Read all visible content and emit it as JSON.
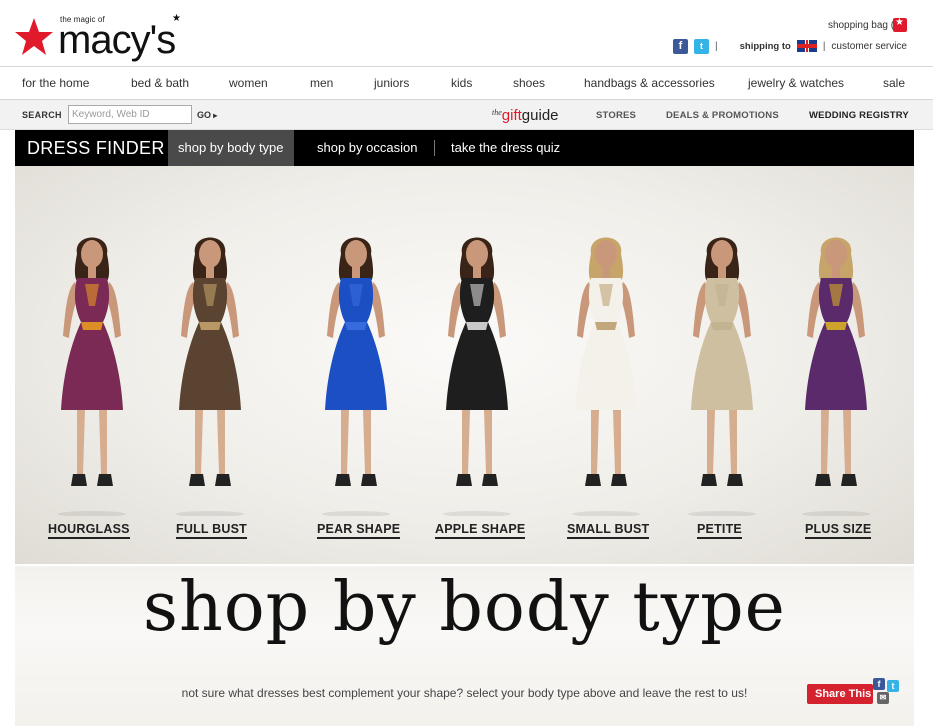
{
  "header": {
    "logo_tagline": "the magic of",
    "logo_word": "macy's",
    "shopping_bag": "shopping bag (0)",
    "shipping_label": "shipping to",
    "customer_service": "customer service",
    "separator": "|"
  },
  "main_nav": [
    "for the home",
    "bed & bath",
    "women",
    "men",
    "juniors",
    "kids",
    "shoes",
    "handbags & accessories",
    "jewelry & watches",
    "sale"
  ],
  "search": {
    "label": "SEARCH",
    "placeholder": "Keyword, Web ID",
    "go": "GO"
  },
  "gift_guide": {
    "the": "the",
    "gift": "gift",
    "guide": "guide"
  },
  "sub_links": {
    "stores": "STORES",
    "deals": "DEALS & PROMOTIONS",
    "registry": "WEDDING REGISTRY"
  },
  "dress_finder": {
    "title": "DRESS FINDER",
    "tabs": [
      "shop by body type",
      "shop by occasion",
      "take the dress quiz"
    ]
  },
  "body_types": [
    {
      "label": "HOURGLASS",
      "dress_color": "#7a2a55",
      "accent": "#f0a020"
    },
    {
      "label": "FULL BUST",
      "dress_color": "#5a4330",
      "accent": "#c9a870"
    },
    {
      "label": "PEAR SHAPE",
      "dress_color": "#1c4fc4",
      "accent": "#3a70e0"
    },
    {
      "label": "APPLE SHAPE",
      "dress_color": "#1e1e1e",
      "accent": "#e8e8e8"
    },
    {
      "label": "SMALL BUST",
      "dress_color": "#f4f1ea",
      "accent": "#b89a6a"
    },
    {
      "label": "PETITE",
      "dress_color": "#cdbf9f",
      "accent": "#bfb08e"
    },
    {
      "label": "PLUS SIZE",
      "dress_color": "#5a2a6a",
      "accent": "#e2b820"
    }
  ],
  "promo": {
    "title": "shop by body type",
    "subtitle": "not sure what dresses best complement your shape? select your body type above and leave the rest to us!",
    "share": "Share This"
  },
  "colors": {
    "brand_red": "#e11a2b",
    "nav_black": "#000000",
    "active_tab": "#4a4a4a"
  }
}
